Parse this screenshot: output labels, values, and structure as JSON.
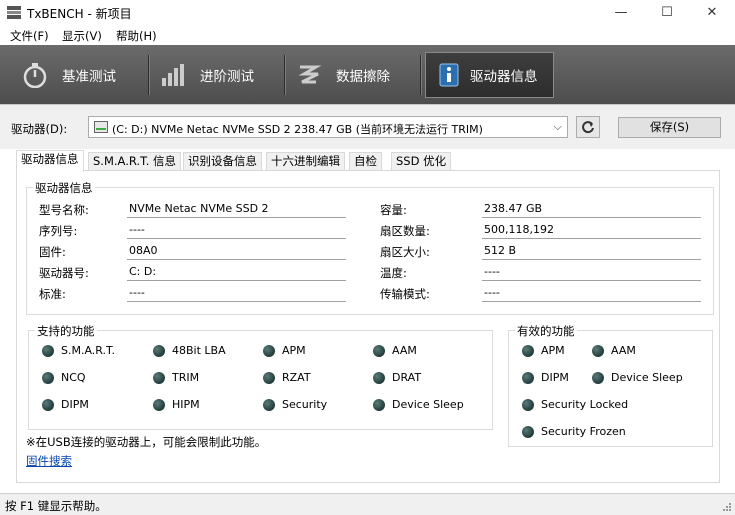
{
  "window": {
    "title": "TxBENCH - 新项目"
  },
  "menu": [
    "文件(F)",
    "显示(V)",
    "帮助(H)"
  ],
  "toolbar": [
    {
      "label": "基准测试"
    },
    {
      "label": "进阶测试"
    },
    {
      "label": "数据擦除"
    },
    {
      "label": "驱动器信息"
    }
  ],
  "drive": {
    "label": "驱动器(D):",
    "selected": "(C: D:) NVMe Netac NVMe SSD 2  238.47 GB (当前环境无法运行 TRIM)",
    "save": "保存(S)"
  },
  "tabs": [
    "驱动器信息",
    "S.M.A.R.T. 信息",
    "识别设备信息",
    "十六进制编辑",
    "自检",
    "SSD 优化"
  ],
  "info": {
    "group_title": "驱动器信息",
    "left": [
      {
        "label": "型号名称:",
        "value": "NVMe Netac NVMe SSD 2"
      },
      {
        "label": "序列号:",
        "value": "----"
      },
      {
        "label": "固件:",
        "value": "08A0"
      },
      {
        "label": "驱动器号:",
        "value": "C: D:"
      },
      {
        "label": "标准:",
        "value": "----"
      }
    ],
    "right": [
      {
        "label": "容量:",
        "value": "238.47 GB"
      },
      {
        "label": "扇区数量:",
        "value": "500,118,192"
      },
      {
        "label": "扇区大小:",
        "value": "512 B"
      },
      {
        "label": "温度:",
        "value": "----"
      },
      {
        "label": "传输模式:",
        "value": "----"
      }
    ]
  },
  "supported": {
    "title": "支持的功能",
    "items": [
      "S.M.A.R.T.",
      "48Bit LBA",
      "APM",
      "AAM",
      "NCQ",
      "TRIM",
      "RZAT",
      "DRAT",
      "DIPM",
      "HIPM",
      "Security",
      "Device Sleep"
    ]
  },
  "enabled": {
    "title": "有效的功能",
    "items": [
      "APM",
      "AAM",
      "DIPM",
      "Device Sleep",
      "Security Locked",
      "Security Frozen"
    ]
  },
  "note": "※在USB连接的驱动器上，可能会限制此功能。",
  "link": "固件搜索",
  "status": "按 F1 键显示帮助。"
}
